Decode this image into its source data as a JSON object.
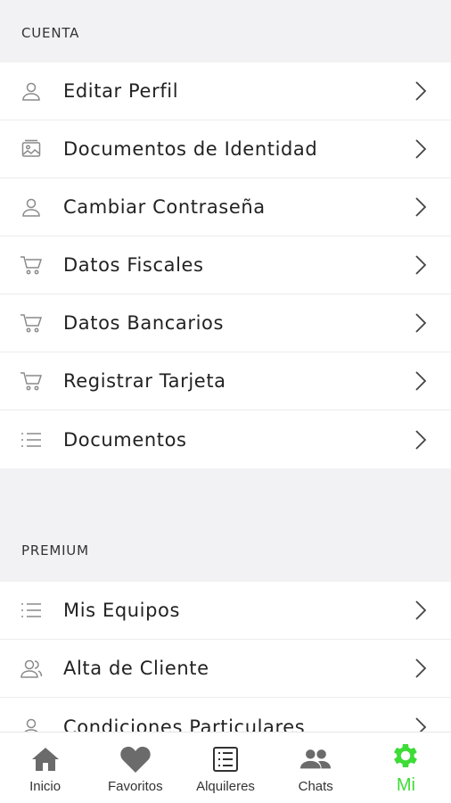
{
  "sections": [
    {
      "header": "CUENTA",
      "items": [
        {
          "label": "Editar Perfil",
          "icon": "user-icon"
        },
        {
          "label": "Documentos de Identidad",
          "icon": "id-card-icon"
        },
        {
          "label": "Cambiar Contraseña",
          "icon": "user-icon"
        },
        {
          "label": "Datos Fiscales",
          "icon": "cart-icon"
        },
        {
          "label": "Datos Bancarios",
          "icon": "cart-icon"
        },
        {
          "label": "Registrar Tarjeta",
          "icon": "cart-icon"
        },
        {
          "label": "Documentos",
          "icon": "list-icon"
        }
      ]
    },
    {
      "header": "PREMIUM",
      "items": [
        {
          "label": "Mis Equipos",
          "icon": "list-icon"
        },
        {
          "label": "Alta de Cliente",
          "icon": "users-icon"
        },
        {
          "label": "Condiciones Particulares",
          "icon": "user-icon"
        }
      ]
    }
  ],
  "tabbar": [
    {
      "label": "Inicio",
      "icon": "home-icon"
    },
    {
      "label": "Favoritos",
      "icon": "heart-icon"
    },
    {
      "label": "Alquileres",
      "icon": "list-box-icon"
    },
    {
      "label": "Chats",
      "icon": "people-icon"
    },
    {
      "label": "Mi",
      "icon": "gear-icon",
      "active": true
    }
  ],
  "colors": {
    "accent": "#3ddc36",
    "background": "#f2f2f4",
    "icon_gray": "#8a8a8a",
    "tab_icon_gray": "#6b6b6b"
  }
}
